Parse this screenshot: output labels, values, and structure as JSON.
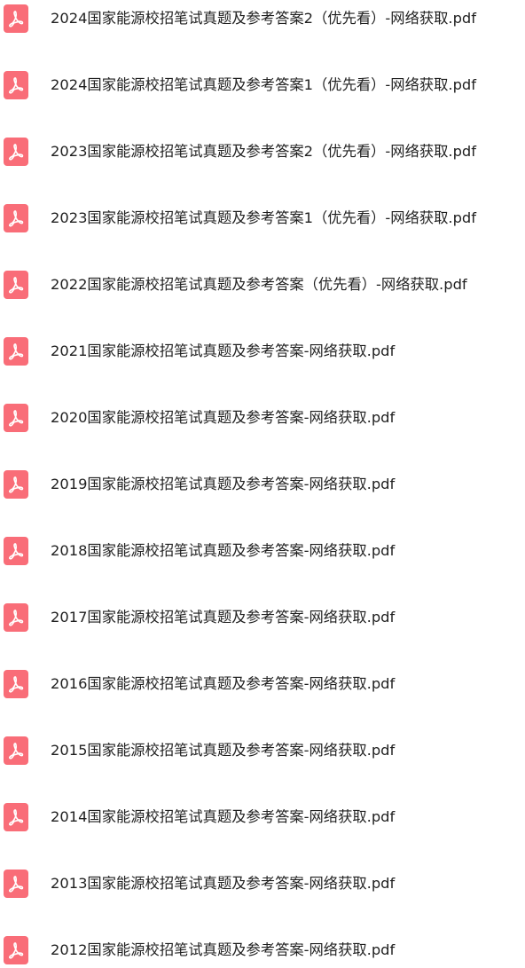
{
  "file_list": {
    "icon": "pdf-file-icon",
    "icon_color": "#f96d78",
    "items": [
      {
        "name": "2024国家能源校招笔试真题及参考答案2（优先看）-网络获取.pdf"
      },
      {
        "name": "2024国家能源校招笔试真题及参考答案1（优先看）-网络获取.pdf"
      },
      {
        "name": "2023国家能源校招笔试真题及参考答案2（优先看）-网络获取.pdf"
      },
      {
        "name": "2023国家能源校招笔试真题及参考答案1（优先看）-网络获取.pdf"
      },
      {
        "name": "2022国家能源校招笔试真题及参考答案（优先看）-网络获取.pdf"
      },
      {
        "name": "2021国家能源校招笔试真题及参考答案-网络获取.pdf"
      },
      {
        "name": "2020国家能源校招笔试真题及参考答案-网络获取.pdf"
      },
      {
        "name": "2019国家能源校招笔试真题及参考答案-网络获取.pdf"
      },
      {
        "name": "2018国家能源校招笔试真题及参考答案-网络获取.pdf"
      },
      {
        "name": "2017国家能源校招笔试真题及参考答案-网络获取.pdf"
      },
      {
        "name": "2016国家能源校招笔试真题及参考答案-网络获取.pdf"
      },
      {
        "name": "2015国家能源校招笔试真题及参考答案-网络获取.pdf"
      },
      {
        "name": "2014国家能源校招笔试真题及参考答案-网络获取.pdf"
      },
      {
        "name": "2013国家能源校招笔试真题及参考答案-网络获取.pdf"
      },
      {
        "name": "2012国家能源校招笔试真题及参考答案-网络获取.pdf"
      }
    ]
  }
}
